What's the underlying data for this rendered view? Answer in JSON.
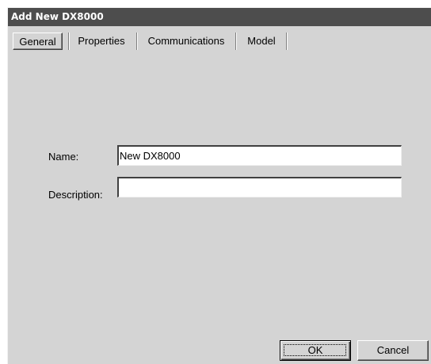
{
  "window": {
    "title": "Add New DX8000"
  },
  "tabs": [
    {
      "label": "General",
      "active": true
    },
    {
      "label": "Properties",
      "active": false
    },
    {
      "label": "Communications",
      "active": false
    },
    {
      "label": "Model",
      "active": false
    }
  ],
  "form": {
    "name_label": "Name:",
    "name_value": "New DX8000",
    "description_label": "Description:",
    "description_value": ""
  },
  "buttons": {
    "ok_label": "OK",
    "cancel_label": "Cancel"
  },
  "colors": {
    "dialog_background": "#d4d4d4",
    "titlebar_background": "#4d4d4d",
    "titlebar_text": "#ffffff"
  }
}
